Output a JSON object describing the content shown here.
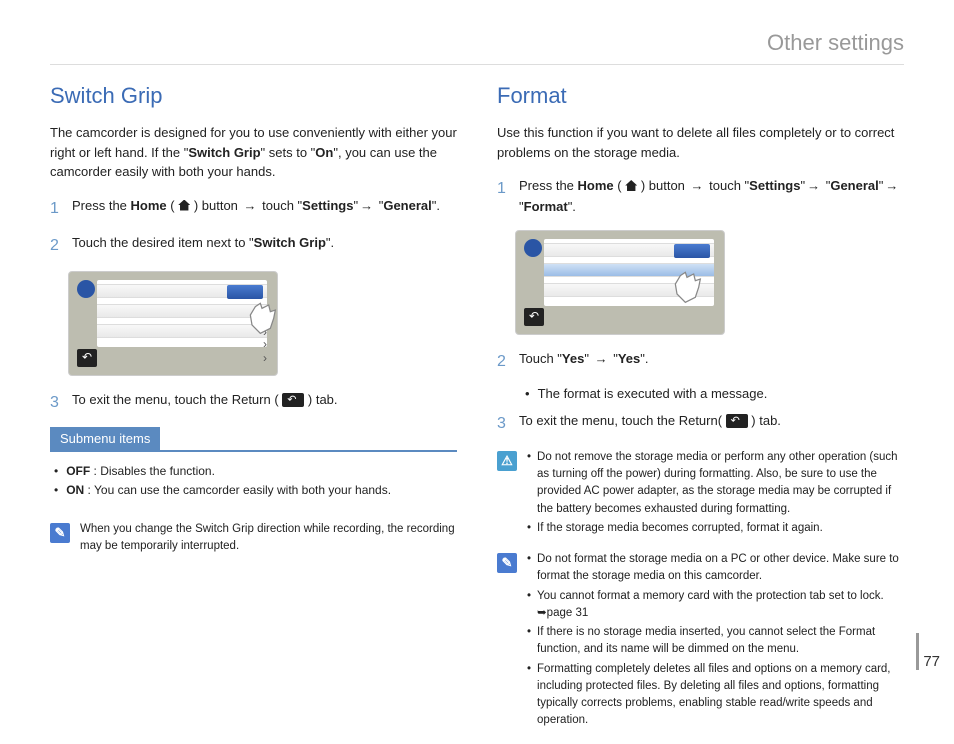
{
  "header": "Other settings",
  "page_number": "77",
  "left": {
    "title": "Switch Grip",
    "intro_a": "The camcorder is designed for you to use conveniently with either your right or left hand. If the \"",
    "intro_b": "Switch Grip",
    "intro_c": "\" sets to \"",
    "intro_d": "On",
    "intro_e": "\", you can use the camcorder easily with both your hands.",
    "step1_a": "Press the ",
    "step1_home": "Home",
    "step1_b": " ( ",
    "step1_c": " ) button ",
    "step1_d": " touch \"",
    "step1_settings": "Settings",
    "step1_e": " \"",
    "step1_general": "General",
    "step1_f": "\".",
    "step2_a": "Touch the desired item next to \"",
    "step2_b": "Switch Grip",
    "step2_c": "\".",
    "step3_a": "To exit the menu, touch the Return ( ",
    "step3_b": " ) tab.",
    "submenu_title": "Submenu items",
    "sub_off_label": "OFF",
    "sub_off_text": " : Disables the function.",
    "sub_on_label": "ON",
    "sub_on_text": " : You can use the camcorder easily with both your hands.",
    "note1": "When you change the Switch Grip direction while recording, the recording may be temporarily interrupted."
  },
  "right": {
    "title": "Format",
    "intro": "Use this function if you want to delete all files completely or to correct problems on the storage media.",
    "step1_a": "Press the ",
    "step1_home": "Home",
    "step1_b": " ( ",
    "step1_c": " ) button ",
    "step1_d": " touch \"",
    "step1_settings": "Settings",
    "step1_e": " \"",
    "step1_general": "General",
    "step1_f": " \"",
    "step1_format": "Format",
    "step1_g": "\".",
    "step2_a": "Touch \"",
    "step2_yes1": "Yes",
    "step2_b": "\" ",
    "step2_c": " \"",
    "step2_yes2": "Yes",
    "step2_d": "\".",
    "step2_bullet": "The format is executed with a message.",
    "step3_a": "To exit the menu, touch the Return( ",
    "step3_b": " ) tab.",
    "warn1_a": "Do not remove the storage media or perform any other operation (such as turning off the power) during formatting. Also, be sure to use the provided AC power adapter, as the storage media may be corrupted if the battery becomes exhausted during formatting.",
    "warn1_b": "If the storage media becomes corrupted, format it again.",
    "note2_a": "Do not format the storage media on a PC or other device. Make sure to format the storage media on this camcorder.",
    "note2_b": "You cannot format a memory card with the protection tab set to lock. ➥page 31",
    "note2_c": "If there is no storage media inserted, you cannot select the Format function, and its name will be dimmed on the menu.",
    "note2_d": "Formatting completely deletes all files and options on a memory card, including protected files. By deleting all files and options, formatting typically corrects problems, enabling stable read/write speeds and operation."
  }
}
